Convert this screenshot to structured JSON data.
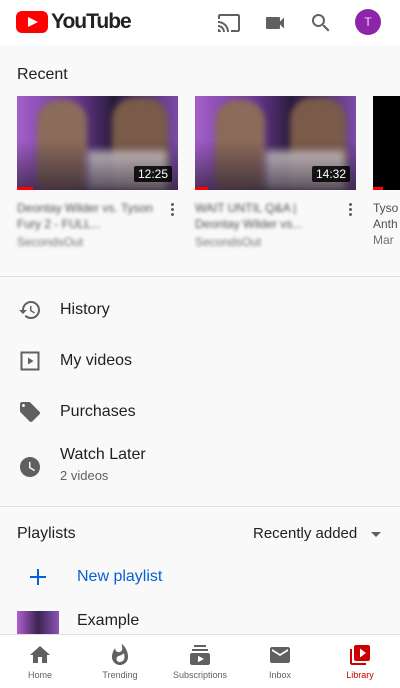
{
  "app": {
    "brand": "YouTube",
    "avatar_initial": "T",
    "accent": "#ff0000",
    "avatar_color": "#8e24aa"
  },
  "top_actions": [
    {
      "name": "cast-icon"
    },
    {
      "name": "video-camera-icon"
    },
    {
      "name": "search-icon"
    }
  ],
  "recent": {
    "title": "Recent",
    "videos": [
      {
        "duration": "12:25",
        "title": "Deontay Wilder vs. Tyson Fury 2 - FULL...",
        "channel": "SecondsOut",
        "progress_fraction": 0.1
      },
      {
        "duration": "14:32",
        "title": "WAIT UNTIL Q&A | Deontay Wilder vs...",
        "channel": "SecondsOut",
        "progress_fraction": 0.08
      }
    ],
    "partial_card": {
      "line1": "Tyso",
      "line2": "Anth",
      "line3": "Mar"
    }
  },
  "menu": [
    {
      "icon": "history-icon",
      "label": "History",
      "sub": ""
    },
    {
      "icon": "my-videos-icon",
      "label": "My videos",
      "sub": ""
    },
    {
      "icon": "tag-icon",
      "label": "Purchases",
      "sub": ""
    },
    {
      "icon": "clock-icon",
      "label": "Watch Later",
      "sub": "2 videos"
    }
  ],
  "playlists": {
    "title": "Playlists",
    "sort_label": "Recently added",
    "new_label": "New playlist",
    "items": [
      {
        "label": "Example"
      }
    ]
  },
  "bottom_nav": [
    {
      "icon": "home-icon",
      "label": "Home",
      "active": false
    },
    {
      "icon": "trending-icon",
      "label": "Trending",
      "active": false
    },
    {
      "icon": "subscriptions-icon",
      "label": "Subscriptions",
      "active": false
    },
    {
      "icon": "inbox-icon",
      "label": "Inbox",
      "active": false
    },
    {
      "icon": "library-icon",
      "label": "Library",
      "active": true
    }
  ]
}
